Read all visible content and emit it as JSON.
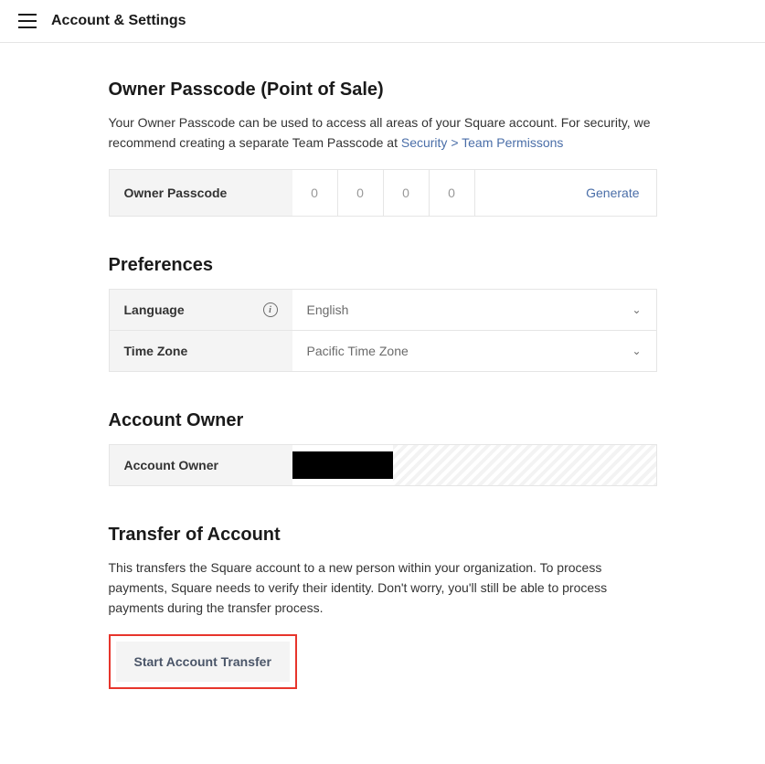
{
  "header": {
    "title": "Account & Settings"
  },
  "owner_passcode": {
    "title": "Owner Passcode (Point of Sale)",
    "desc_prefix": "Your Owner Passcode can be used to access all areas of your Square account. For security, we recommend creating a separate Team Passcode at ",
    "desc_link": "Security > Team Permissons",
    "label": "Owner Passcode",
    "digits": [
      "0",
      "0",
      "0",
      "0"
    ],
    "generate": "Generate"
  },
  "preferences": {
    "title": "Preferences",
    "language_label": "Language",
    "language_value": "English",
    "timezone_label": "Time Zone",
    "timezone_value": "Pacific Time Zone"
  },
  "account_owner": {
    "title": "Account Owner",
    "label": "Account Owner"
  },
  "transfer": {
    "title": "Transfer of Account",
    "desc": "This transfers the Square account to a new person within your organization. To process payments, Square needs to verify their identity. Don't worry, you'll still be able to process payments during the transfer process.",
    "button": "Start Account Transfer"
  }
}
